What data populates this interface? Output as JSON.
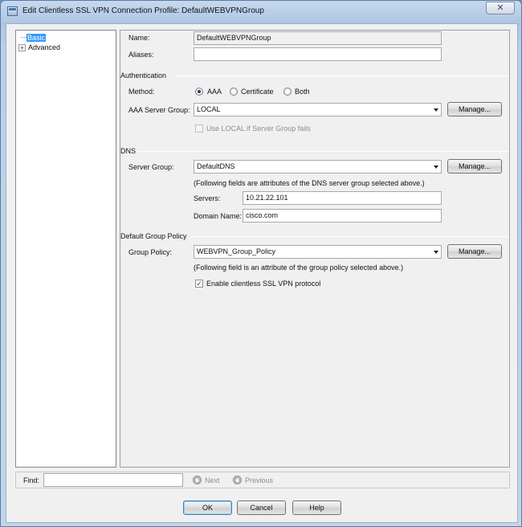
{
  "window": {
    "title": "Edit Clientless SSL VPN Connection Profile: DefaultWEBVPNGroup",
    "close_glyph": "✕"
  },
  "tree": {
    "items": [
      {
        "label": "Basic",
        "selected": true
      },
      {
        "label": "Advanced",
        "expander": "⊞"
      }
    ]
  },
  "form": {
    "name_label": "Name:",
    "name_value": "DefaultWEBVPNGroup",
    "aliases_label": "Aliases:",
    "aliases_value": ""
  },
  "authentication": {
    "section_label": "Authentication",
    "method_label": "Method:",
    "methods": [
      {
        "label": "AAA",
        "selected": true
      },
      {
        "label": "Certificate",
        "selected": false
      },
      {
        "label": "Both",
        "selected": false
      }
    ],
    "aaa_server_group_label": "AAA Server Group:",
    "aaa_server_group_value": "LOCAL",
    "manage_label": "Manage...",
    "use_local_label": "Use LOCAL if Server Group fails",
    "use_local_checked": false
  },
  "dns": {
    "section_label": "DNS",
    "server_group_label": "Server Group:",
    "server_group_value": "DefaultDNS",
    "manage_label": "Manage...",
    "note": "(Following fields are attributes of the DNS server group selected above.)",
    "servers_label": "Servers:",
    "servers_value": "10.21.22.101",
    "domain_label": "Domain Name:",
    "domain_value": "cisco.com"
  },
  "group_policy": {
    "section_label": "Default Group Policy",
    "policy_label": "Group Policy:",
    "policy_value": "WEBVPN_Group_Policy",
    "manage_label": "Manage...",
    "note": "(Following field is an attribute of the group policy selected above.)",
    "enable_label": "Enable clientless SSL VPN protocol",
    "enable_checked": true,
    "check_glyph": "✓"
  },
  "find": {
    "label": "Find:",
    "value": "",
    "next_label": "Next",
    "previous_label": "Previous"
  },
  "buttons": {
    "ok": "OK",
    "cancel": "Cancel",
    "help": "Help"
  }
}
